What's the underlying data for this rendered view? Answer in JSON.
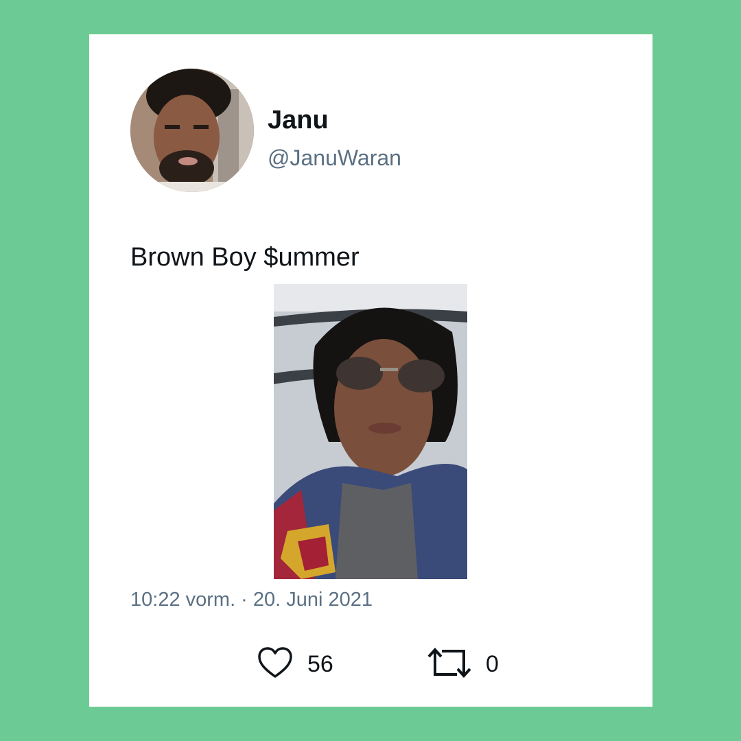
{
  "tweet": {
    "author_name": "Janu",
    "author_handle": "@JanuWaran",
    "text": "Brown Boy $ummer",
    "timestamp": "10:22 vorm. · 20. Juni 2021",
    "likes": "56",
    "retweets": "0"
  },
  "icons": {
    "like": "heart-icon",
    "retweet": "retweet-icon"
  },
  "colors": {
    "background": "#6ccb94",
    "card": "#ffffff",
    "text_primary": "#0f1419",
    "text_secondary": "#5b7083"
  }
}
